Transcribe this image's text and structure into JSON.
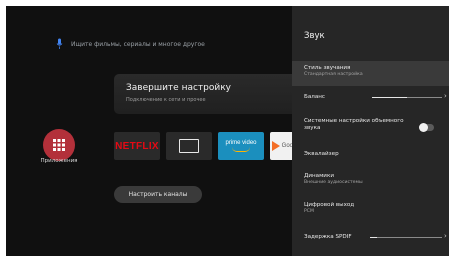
{
  "search": {
    "icon": "mic-icon",
    "placeholder": "Ищите фильмы, сериалы и многое другое"
  },
  "setup_card": {
    "title": "Завершите настройку",
    "subtitle": "Подключение к сети и прочее"
  },
  "apps": {
    "icon": "apps-grid-icon",
    "label": "Приложения"
  },
  "tiles": [
    {
      "name": "netflix",
      "label": "NETFLIX"
    },
    {
      "name": "live-tv",
      "label": ""
    },
    {
      "name": "prime-video",
      "label": "prime video"
    },
    {
      "name": "google-play",
      "label": "Google Play"
    }
  ],
  "channels_button": {
    "label": "Настроить каналы"
  },
  "panel": {
    "title": "Звук",
    "items": [
      {
        "label": "Стиль звучания",
        "value": "Стандартная настройка"
      },
      {
        "label": "Баланс",
        "slider_fraction": 0.5
      },
      {
        "label": "Системные настройки объемного звука",
        "toggle_on": false
      },
      {
        "label": "Эквалайзер"
      },
      {
        "label": "Динамики",
        "value": "Внешние аудиосистемы"
      },
      {
        "label": "Цифровой выход",
        "value": "PCM"
      },
      {
        "label": "Задержка SPDIF",
        "slider_fraction": 0.1
      }
    ]
  },
  "colors": {
    "accent_apps": "#b3303a",
    "background": "#101010",
    "panel": "#262626"
  }
}
